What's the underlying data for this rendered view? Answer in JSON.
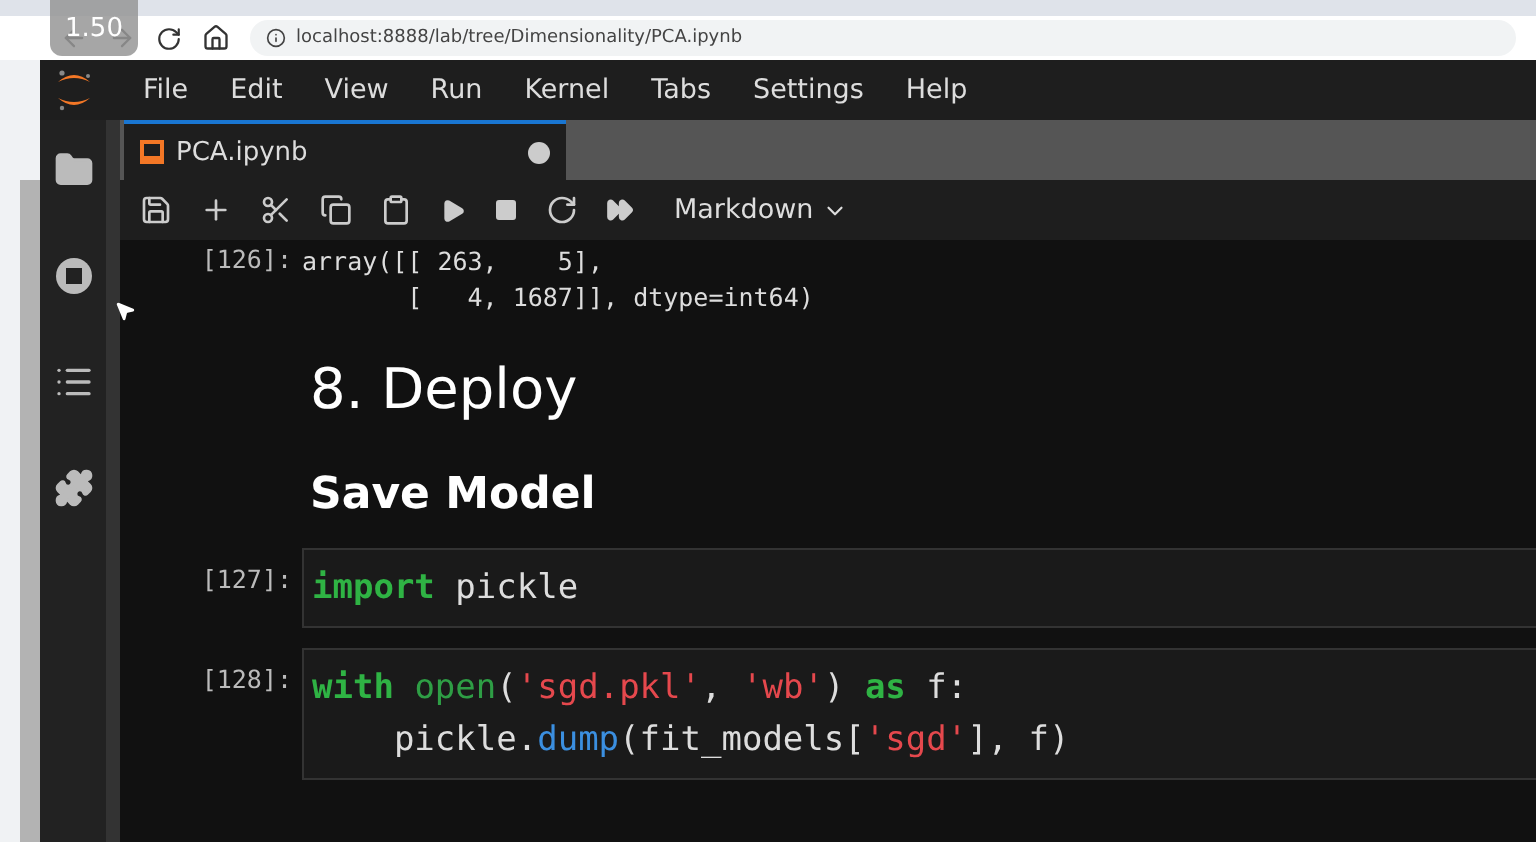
{
  "browser": {
    "speed_badge": "1.50",
    "url": "localhost:8888/lab/tree/Dimensionality/PCA.ipynb"
  },
  "menu": [
    "File",
    "Edit",
    "View",
    "Run",
    "Kernel",
    "Tabs",
    "Settings",
    "Help"
  ],
  "tab": {
    "title": "PCA.ipynb",
    "unsaved": true,
    "selected": true
  },
  "toolbar": {
    "cell_type": "Markdown"
  },
  "cells": [
    {
      "kind": "output",
      "prompt": "[126]:",
      "lines": [
        "array([[ 263,    5],",
        "       [   4, 1687]], dtype=int64)"
      ]
    },
    {
      "kind": "title",
      "text": "8. Deploy"
    },
    {
      "kind": "subtitle",
      "text": "Save Model"
    },
    {
      "kind": "code",
      "prompt": "[127]:",
      "lines": [
        [
          {
            "kind": "keyword",
            "text": "import"
          },
          {
            "kind": "plain",
            "text": " pickle"
          }
        ]
      ]
    },
    {
      "kind": "code",
      "prompt": "[128]:",
      "lines": [
        [
          {
            "kind": "keyword",
            "text": "with"
          },
          {
            "kind": "builtin",
            "text": " open"
          },
          {
            "kind": "plain",
            "text": "("
          },
          {
            "kind": "string",
            "text": "'sgd.pkl'"
          },
          {
            "kind": "plain",
            "text": ", "
          },
          {
            "kind": "string",
            "text": "'wb'"
          },
          {
            "kind": "plain",
            "text": ") "
          },
          {
            "kind": "keyword",
            "text": "as"
          },
          {
            "kind": "plain",
            "text": " f:"
          }
        ],
        [
          {
            "kind": "plain",
            "text": "    pickle."
          },
          {
            "kind": "function",
            "text": "dump"
          },
          {
            "kind": "plain",
            "text": "(fit_models["
          },
          {
            "kind": "string",
            "text": "'sgd'"
          },
          {
            "kind": "plain",
            "text": "], f)"
          }
        ]
      ]
    }
  ]
}
